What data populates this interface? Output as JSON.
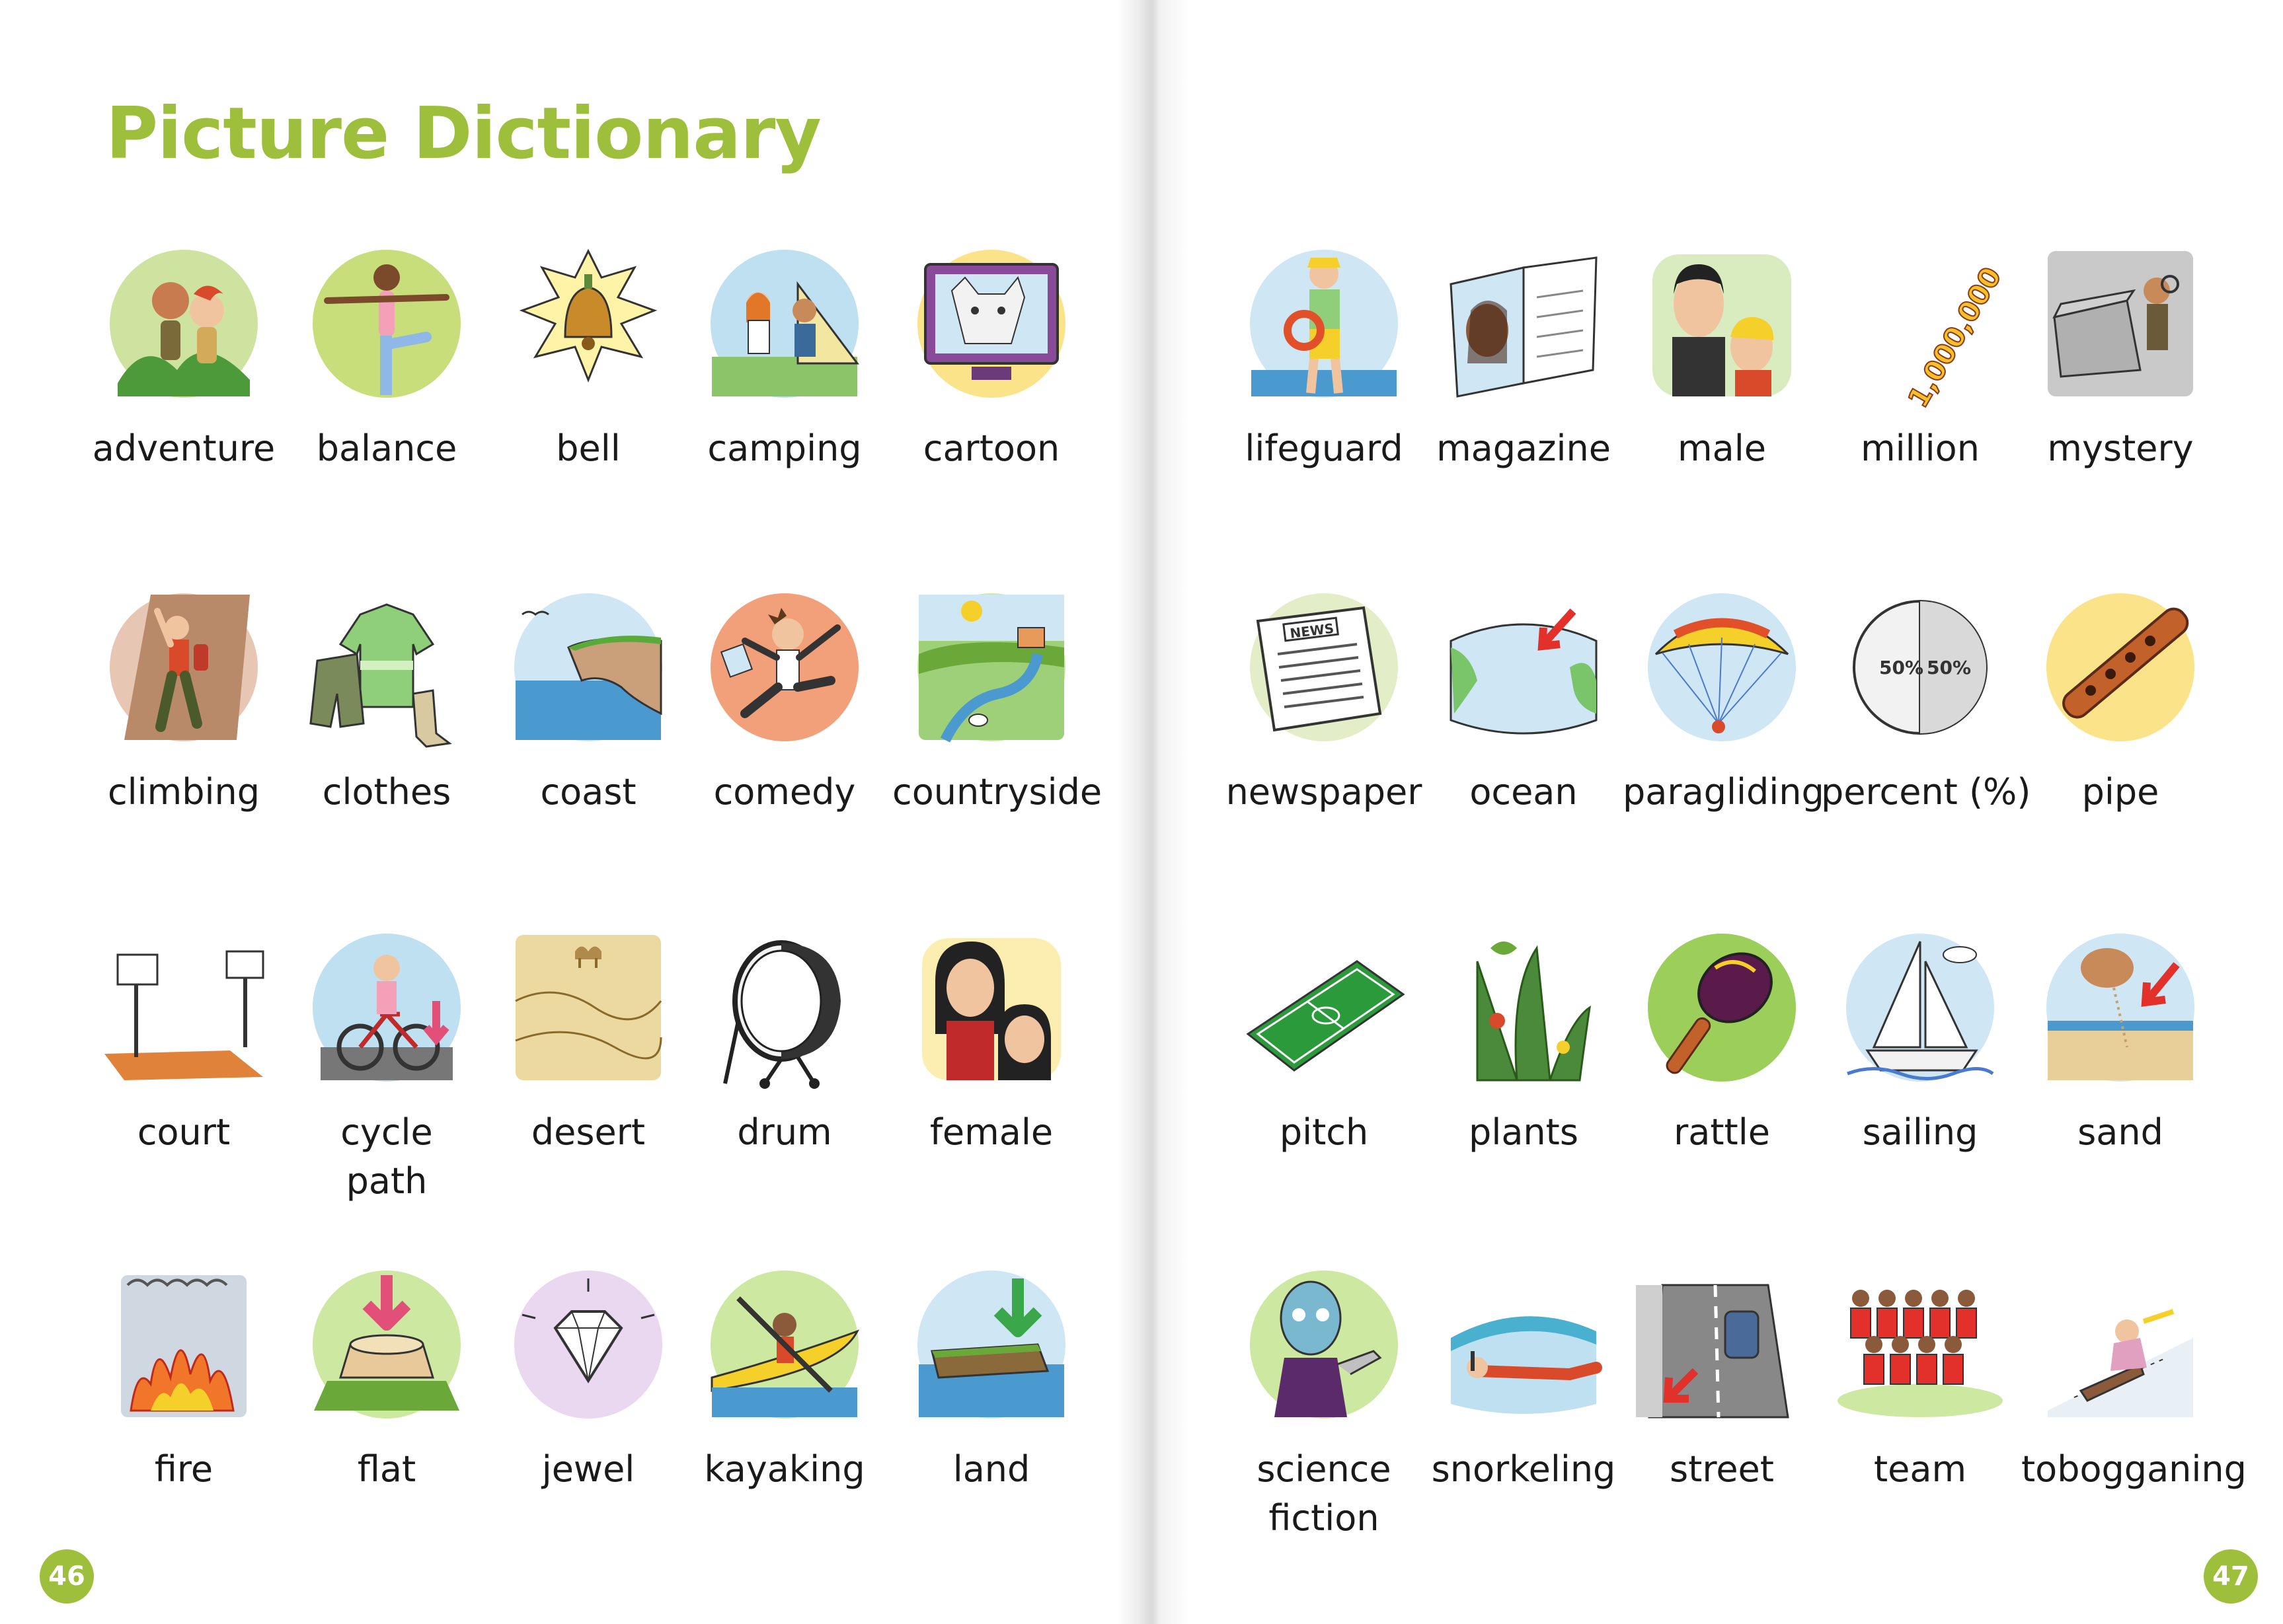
{
  "title": "Picture Dictionary",
  "accent_color": "#9dbf3b",
  "page_numbers": {
    "left": "46",
    "right": "47"
  },
  "entries": [
    {
      "word": "adventure",
      "icon": "adventure-icon",
      "bg": "#cfe3a0"
    },
    {
      "word": "balance",
      "icon": "balance-icon",
      "bg": "#c8de7a"
    },
    {
      "word": "bell",
      "icon": "bell-icon",
      "bg": "#fff3a8"
    },
    {
      "word": "camping",
      "icon": "camping-icon",
      "bg": "#bfe0f0"
    },
    {
      "word": "cartoon",
      "icon": "cartoon-icon",
      "bg": "#fbe38a"
    },
    {
      "word": "climbing",
      "icon": "climbing-icon",
      "bg": "#e7c6b4"
    },
    {
      "word": "clothes",
      "icon": "clothes-icon",
      "bg": "#ffffff"
    },
    {
      "word": "coast",
      "icon": "coast-icon",
      "bg": "#cfe6f5"
    },
    {
      "word": "comedy",
      "icon": "comedy-icon",
      "bg": "#f2a07a"
    },
    {
      "word": "countryside",
      "icon": "countryside-icon",
      "bg": "#cde8a0"
    },
    {
      "word": "court",
      "icon": "court-icon",
      "bg": "#ffffff"
    },
    {
      "word": "cycle\npath",
      "icon": "cycle-path-icon",
      "bg": "#bfe0f0"
    },
    {
      "word": "desert",
      "icon": "desert-icon",
      "bg": "#ecd9a0"
    },
    {
      "word": "drum",
      "icon": "drum-icon",
      "bg": "#ffffff"
    },
    {
      "word": "female",
      "icon": "female-icon",
      "bg": "#fbeeb0"
    },
    {
      "word": "fire",
      "icon": "fire-icon",
      "bg": "#cfd8e0"
    },
    {
      "word": "flat",
      "icon": "flat-icon",
      "bg": "#cde8a0"
    },
    {
      "word": "jewel",
      "icon": "jewel-icon",
      "bg": "#ead7f0"
    },
    {
      "word": "kayaking",
      "icon": "kayaking-icon",
      "bg": "#cde8a0"
    },
    {
      "word": "land",
      "icon": "land-icon",
      "bg": "#cfe6f5"
    },
    {
      "word": "lifeguard",
      "icon": "lifeguard-icon",
      "bg": "#cfe6f5"
    },
    {
      "word": "magazine",
      "icon": "magazine-icon",
      "bg": "#ffffff"
    },
    {
      "word": "male",
      "icon": "male-icon",
      "bg": "#d9ecc0"
    },
    {
      "word": "million",
      "icon": "million-icon",
      "bg": "#ffffff"
    },
    {
      "word": "mystery",
      "icon": "mystery-icon",
      "bg": "#c9c9c9"
    },
    {
      "word": "newspaper",
      "icon": "newspaper-icon",
      "bg": "#e3eec8"
    },
    {
      "word": "ocean",
      "icon": "ocean-icon",
      "bg": "#ffffff"
    },
    {
      "word": "paragliding",
      "icon": "paragliding-icon",
      "bg": "#cfe6f5"
    },
    {
      "word": "percent (%)",
      "icon": "percent-icon",
      "bg": "#ffffff"
    },
    {
      "word": "pipe",
      "icon": "pipe-icon",
      "bg": "#fbe38a"
    },
    {
      "word": "pitch",
      "icon": "pitch-icon",
      "bg": "#ffffff"
    },
    {
      "word": "plants",
      "icon": "plants-icon",
      "bg": "#ffffff"
    },
    {
      "word": "rattle",
      "icon": "rattle-icon",
      "bg": "#9ccf5a"
    },
    {
      "word": "sailing",
      "icon": "sailing-icon",
      "bg": "#cfe6f5"
    },
    {
      "word": "sand",
      "icon": "sand-icon",
      "bg": "#cfe6f5"
    },
    {
      "word": "science\nfiction",
      "icon": "science-fiction-icon",
      "bg": "#cde8a0"
    },
    {
      "word": "snorkeling",
      "icon": "snorkeling-icon",
      "bg": "#bfe0f0"
    },
    {
      "word": "street",
      "icon": "street-icon",
      "bg": "#ffffff"
    },
    {
      "word": "team",
      "icon": "team-icon",
      "bg": "#cde8a0"
    },
    {
      "word": "tobogganing",
      "icon": "tobogganing-icon",
      "bg": "#ffffff"
    }
  ]
}
